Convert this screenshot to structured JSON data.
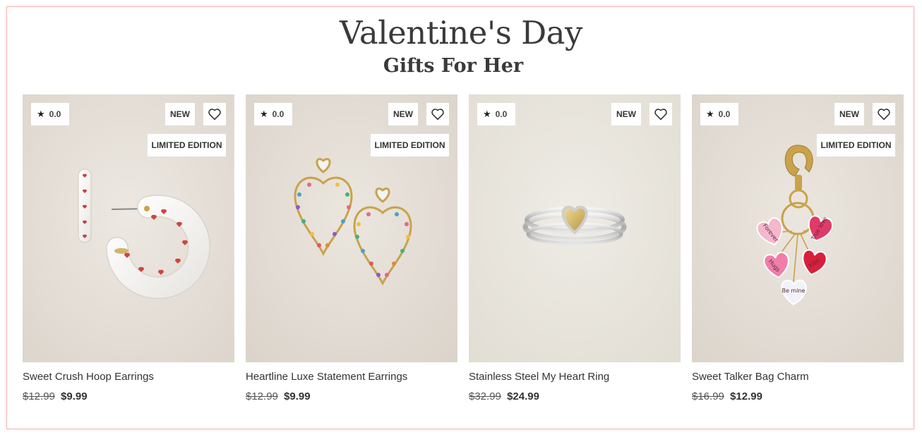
{
  "header": {
    "title": "Valentine's Day",
    "subtitle": "Gifts For Her"
  },
  "colors": {
    "frame_border": "#f2b8b8",
    "image_bg": "#e6e0d9",
    "text": "#333333"
  },
  "products": [
    {
      "rating": "0.0",
      "new_badge": "NEW",
      "limited_badge": "LIMITED EDITION",
      "name": "Sweet Crush Hoop Earrings",
      "old_price": "$12.99",
      "price": "$9.99",
      "image": "white-enamel-heart-hoop-earrings"
    },
    {
      "rating": "0.0",
      "new_badge": "NEW",
      "limited_badge": "LIMITED EDITION",
      "name": "Heartline Luxe Statement Earrings",
      "old_price": "$12.99",
      "price": "$9.99",
      "image": "gold-heart-outline-rhinestone-earrings"
    },
    {
      "rating": "0.0",
      "new_badge": "NEW",
      "name": "Stainless Steel My Heart Ring",
      "old_price": "$32.99",
      "price": "$24.99",
      "image": "silver-band-ring-gold-heart"
    },
    {
      "rating": "0.0",
      "new_badge": "NEW",
      "limited_badge": "LIMITED EDITION",
      "name": "Sweet Talker Bag Charm",
      "old_price": "$16.99",
      "price": "$12.99",
      "image": "conversation-heart-bag-charm",
      "charm_words": [
        "Forever",
        "True love",
        "Hugs",
        "Kiss",
        "Be mine"
      ]
    }
  ]
}
